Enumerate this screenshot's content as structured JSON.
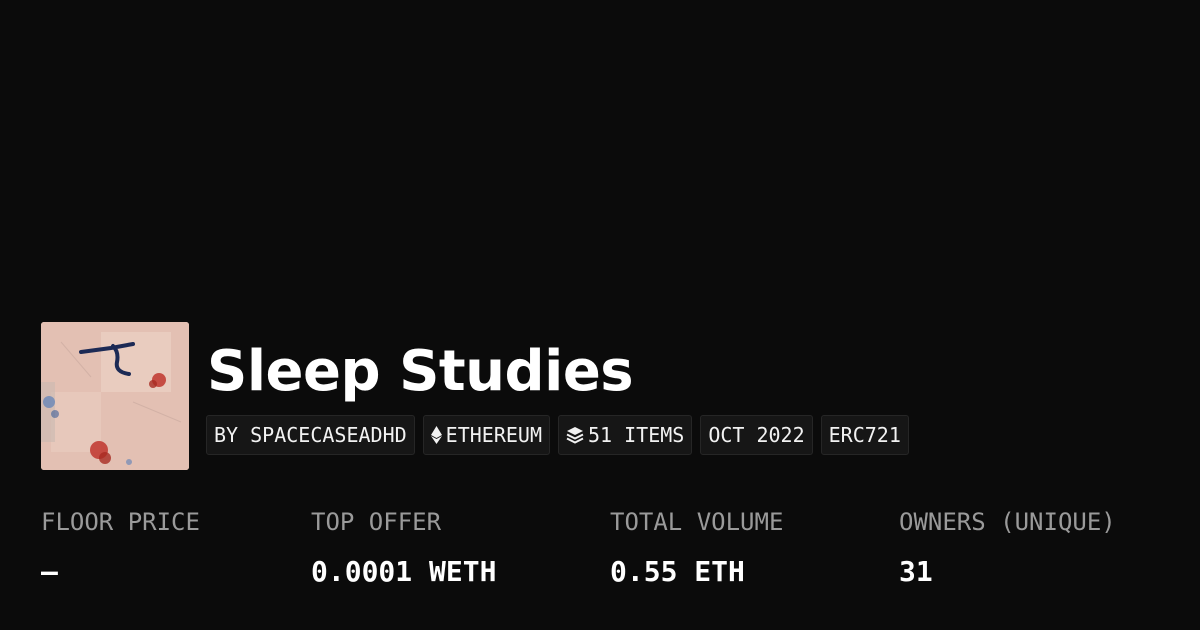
{
  "collection": {
    "title": "Sleep Studies",
    "image_alt": "collection-artwork"
  },
  "tags": {
    "creator": "BY SPACECASEADHD",
    "chain": "ETHEREUM",
    "items": "51 ITEMS",
    "date": "OCT 2022",
    "standard": "ERC721"
  },
  "stats": {
    "floor_price": {
      "label": "FLOOR PRICE",
      "value": "–"
    },
    "top_offer": {
      "label": "TOP OFFER",
      "value": "0.0001 WETH"
    },
    "total_volume": {
      "label": "TOTAL VOLUME",
      "value": "0.55 ETH"
    },
    "owners": {
      "label": "OWNERS (UNIQUE)",
      "value": "31"
    }
  },
  "icons": {
    "chain_icon": "ethereum-icon",
    "items_icon": "layers-icon"
  },
  "colors": {
    "background": "#0b0b0b",
    "tag_background": "#161616",
    "label_gray": "#9a9a9a"
  }
}
